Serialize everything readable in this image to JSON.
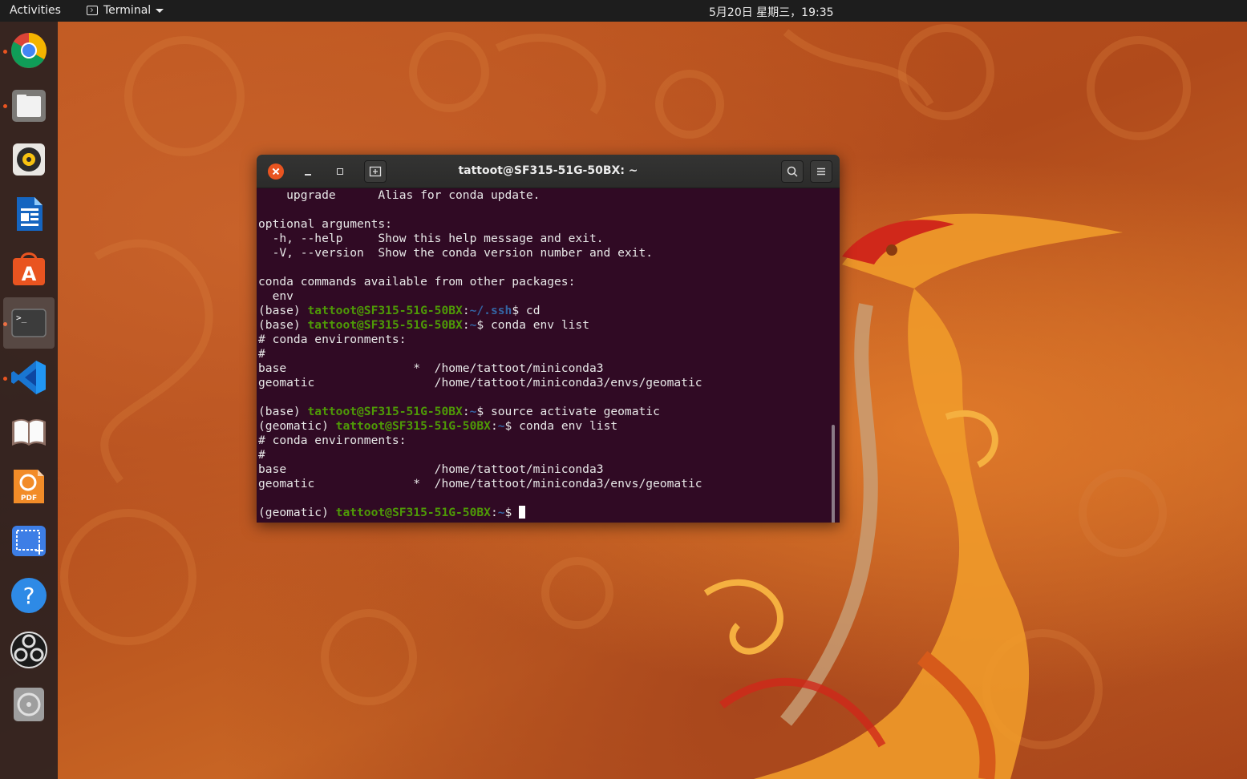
{
  "topbar": {
    "activities": "Activities",
    "app_menu": "Terminal",
    "clock": "5月20日 星期三，19:35"
  },
  "dock": {
    "items": [
      {
        "name": "chrome",
        "running": true
      },
      {
        "name": "files",
        "running": true
      },
      {
        "name": "rhythmbox",
        "running": false
      },
      {
        "name": "libreoffice-writer",
        "running": false
      },
      {
        "name": "ubuntu-software",
        "running": false
      },
      {
        "name": "terminal",
        "running": true,
        "active": true
      },
      {
        "name": "vscode",
        "running": true
      },
      {
        "name": "dictionary",
        "running": false
      },
      {
        "name": "foxit-pdf",
        "running": false
      },
      {
        "name": "screenshot",
        "running": false
      },
      {
        "name": "help",
        "running": false
      },
      {
        "name": "obs-studio",
        "running": false
      },
      {
        "name": "disc",
        "running": false
      }
    ]
  },
  "terminal": {
    "title": "tattoot@SF315-51G-50BX: ~",
    "lines": [
      {
        "text": "    upgrade      Alias for conda update."
      },
      {
        "text": ""
      },
      {
        "text": "optional arguments:"
      },
      {
        "text": "  -h, --help     Show this help message and exit."
      },
      {
        "text": "  -V, --version  Show the conda version number and exit."
      },
      {
        "text": ""
      },
      {
        "text": "conda commands available from other packages:"
      },
      {
        "text": "  env"
      },
      {
        "prompt": true,
        "env": "(base) ",
        "user": "tattoot@SF315-51G-50BX",
        "path": "~/.ssh",
        "cmd": " cd"
      },
      {
        "prompt": true,
        "env": "(base) ",
        "user": "tattoot@SF315-51G-50BX",
        "path": "~",
        "cmd": " conda env list"
      },
      {
        "text": "# conda environments:"
      },
      {
        "text": "#"
      },
      {
        "text": "base                  *  /home/tattoot/miniconda3"
      },
      {
        "text": "geomatic                 /home/tattoot/miniconda3/envs/geomatic"
      },
      {
        "text": ""
      },
      {
        "prompt": true,
        "env": "(base) ",
        "user": "tattoot@SF315-51G-50BX",
        "path": "~",
        "cmd": " source activate geomatic"
      },
      {
        "prompt": true,
        "env": "(geomatic) ",
        "user": "tattoot@SF315-51G-50BX",
        "path": "~",
        "cmd": " conda env list"
      },
      {
        "text": "# conda environments:"
      },
      {
        "text": "#"
      },
      {
        "text": "base                     /home/tattoot/miniconda3"
      },
      {
        "text": "geomatic              *  /home/tattoot/miniconda3/envs/geomatic"
      },
      {
        "text": ""
      },
      {
        "prompt": true,
        "env": "(geomatic) ",
        "user": "tattoot@SF315-51G-50BX",
        "path": "~",
        "cmd": " ",
        "cursor": true
      }
    ]
  },
  "colors": {
    "accent": "#e95420",
    "terminal_bg": "#300a24",
    "prompt_user": "#4e9a06",
    "prompt_path": "#3465a4"
  }
}
